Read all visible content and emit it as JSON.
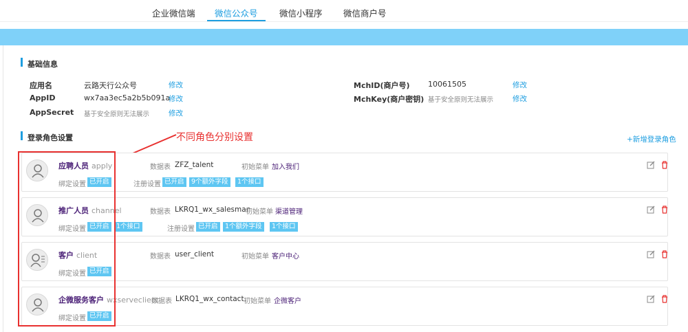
{
  "tabs": [
    "企业微信端",
    "微信公众号",
    "微信小程序",
    "微信商户号"
  ],
  "basic": {
    "title": "基础信息",
    "app_name_label": "应用名",
    "app_name": "云路天行公众号",
    "appid_label": "AppID",
    "appid": "wx7aa3ec5a2b5b091a",
    "secret_label": "AppSecret",
    "secret": "基于安全原则无法展示",
    "mchid_label": "MchID(商户号)",
    "mchid": "10061505",
    "mchkey_label": "MchKey(商户密钥)",
    "mchkey": "基于安全原则无法展示",
    "edit": "修改"
  },
  "roles_section": {
    "title": "登录角色设置",
    "add": "+新增登录角色"
  },
  "annotation": "不同角色分别设置",
  "labels": {
    "table": "数据表",
    "menu": "初始菜单",
    "bind": "绑定设置",
    "reg": "注册设置"
  },
  "roles": [
    {
      "name": "应聘人员",
      "key": "apply",
      "table": "ZFZ_talent",
      "menu": "加入我们",
      "bind": [
        "已开启"
      ],
      "reg": [
        "已开启",
        "9个额外字段",
        "1个接口"
      ]
    },
    {
      "name": "推广人员",
      "key": "channel",
      "table": "LKRQ1_wx_salesman",
      "menu": "渠道管理",
      "bind": [
        "已开启",
        "1个接口"
      ],
      "reg": [
        "已开启",
        "1个额外字段",
        "1个接口"
      ]
    },
    {
      "name": "客户",
      "key": "client",
      "table": "user_client",
      "menu": "客户中心",
      "bind": [
        "已开启"
      ],
      "reg": []
    },
    {
      "name": "企微服务客户",
      "key": "wxserveclient",
      "table": "LKRQ1_wx_contact",
      "menu": "企微客户",
      "bind": [
        "已开启"
      ],
      "reg": []
    }
  ],
  "colors": {
    "accent": "#1e9ee0",
    "role": "#4a1f76",
    "badge": "#5ec6f2",
    "annotation": "#e8302f"
  }
}
